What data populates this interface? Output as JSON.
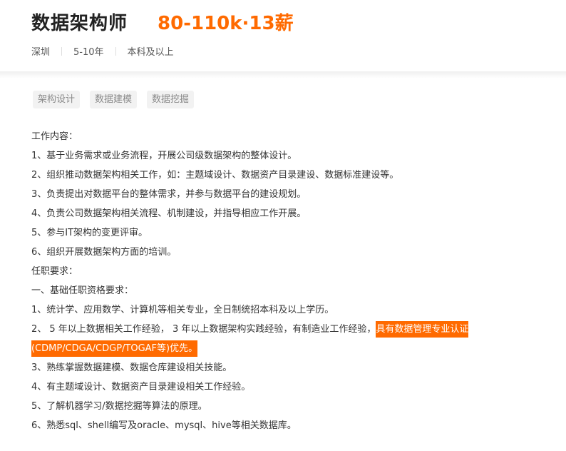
{
  "job": {
    "title": "数据架构师",
    "salary": "80-110k·13薪",
    "location": "深圳",
    "experience": "5-10年",
    "education": "本科及以上"
  },
  "tags": [
    "架构设计",
    "数据建模",
    "数据挖掘"
  ],
  "description": {
    "section_work": "工作内容：",
    "work_items": [
      "1、基于业务需求或业务流程，开展公司级数据架构的整体设计。",
      "2、组织推动数据架构相关工作，如：主题域设计、数据资产目录建设、数据标准建设等。",
      "3、负责提出对数据平台的整体需求，并参与数据平台的建设规划。",
      "4、负责公司数据架构相关流程、机制建设，并指导相应工作开展。",
      "5、参与IT架构的变更评审。",
      "6、组织开展数据架构方面的培训。"
    ],
    "section_req": "任职要求：",
    "subsection_basic": "一、基础任职资格要求：",
    "req_1": "1、统计学、应用数学、计算机等相关专业，全日制统招本科及以上学历。",
    "req_2_plain": "2、 5 年以上数据相关工作经验， 3 年以上数据架构实践经验，有制造业工作经验，",
    "req_2_highlight": "具有数据管理专业认证(CDMP/CDGA/CDGP/TOGAF等)优先。",
    "req_rest": [
      "3、熟练掌握数据建模、数据仓库建设相关技能。",
      "4、有主题域设计、数据资产目录建设相关工作经验。",
      "5、了解机器学习/数据挖掘等算法的原理。",
      "6、熟悉sql、shell编写及oracle、mysql、hive等相关数据库。"
    ]
  },
  "colors": {
    "salary": "#ff6a00",
    "highlight": "#ff6a00",
    "tag_bg": "#f2f2f2"
  }
}
